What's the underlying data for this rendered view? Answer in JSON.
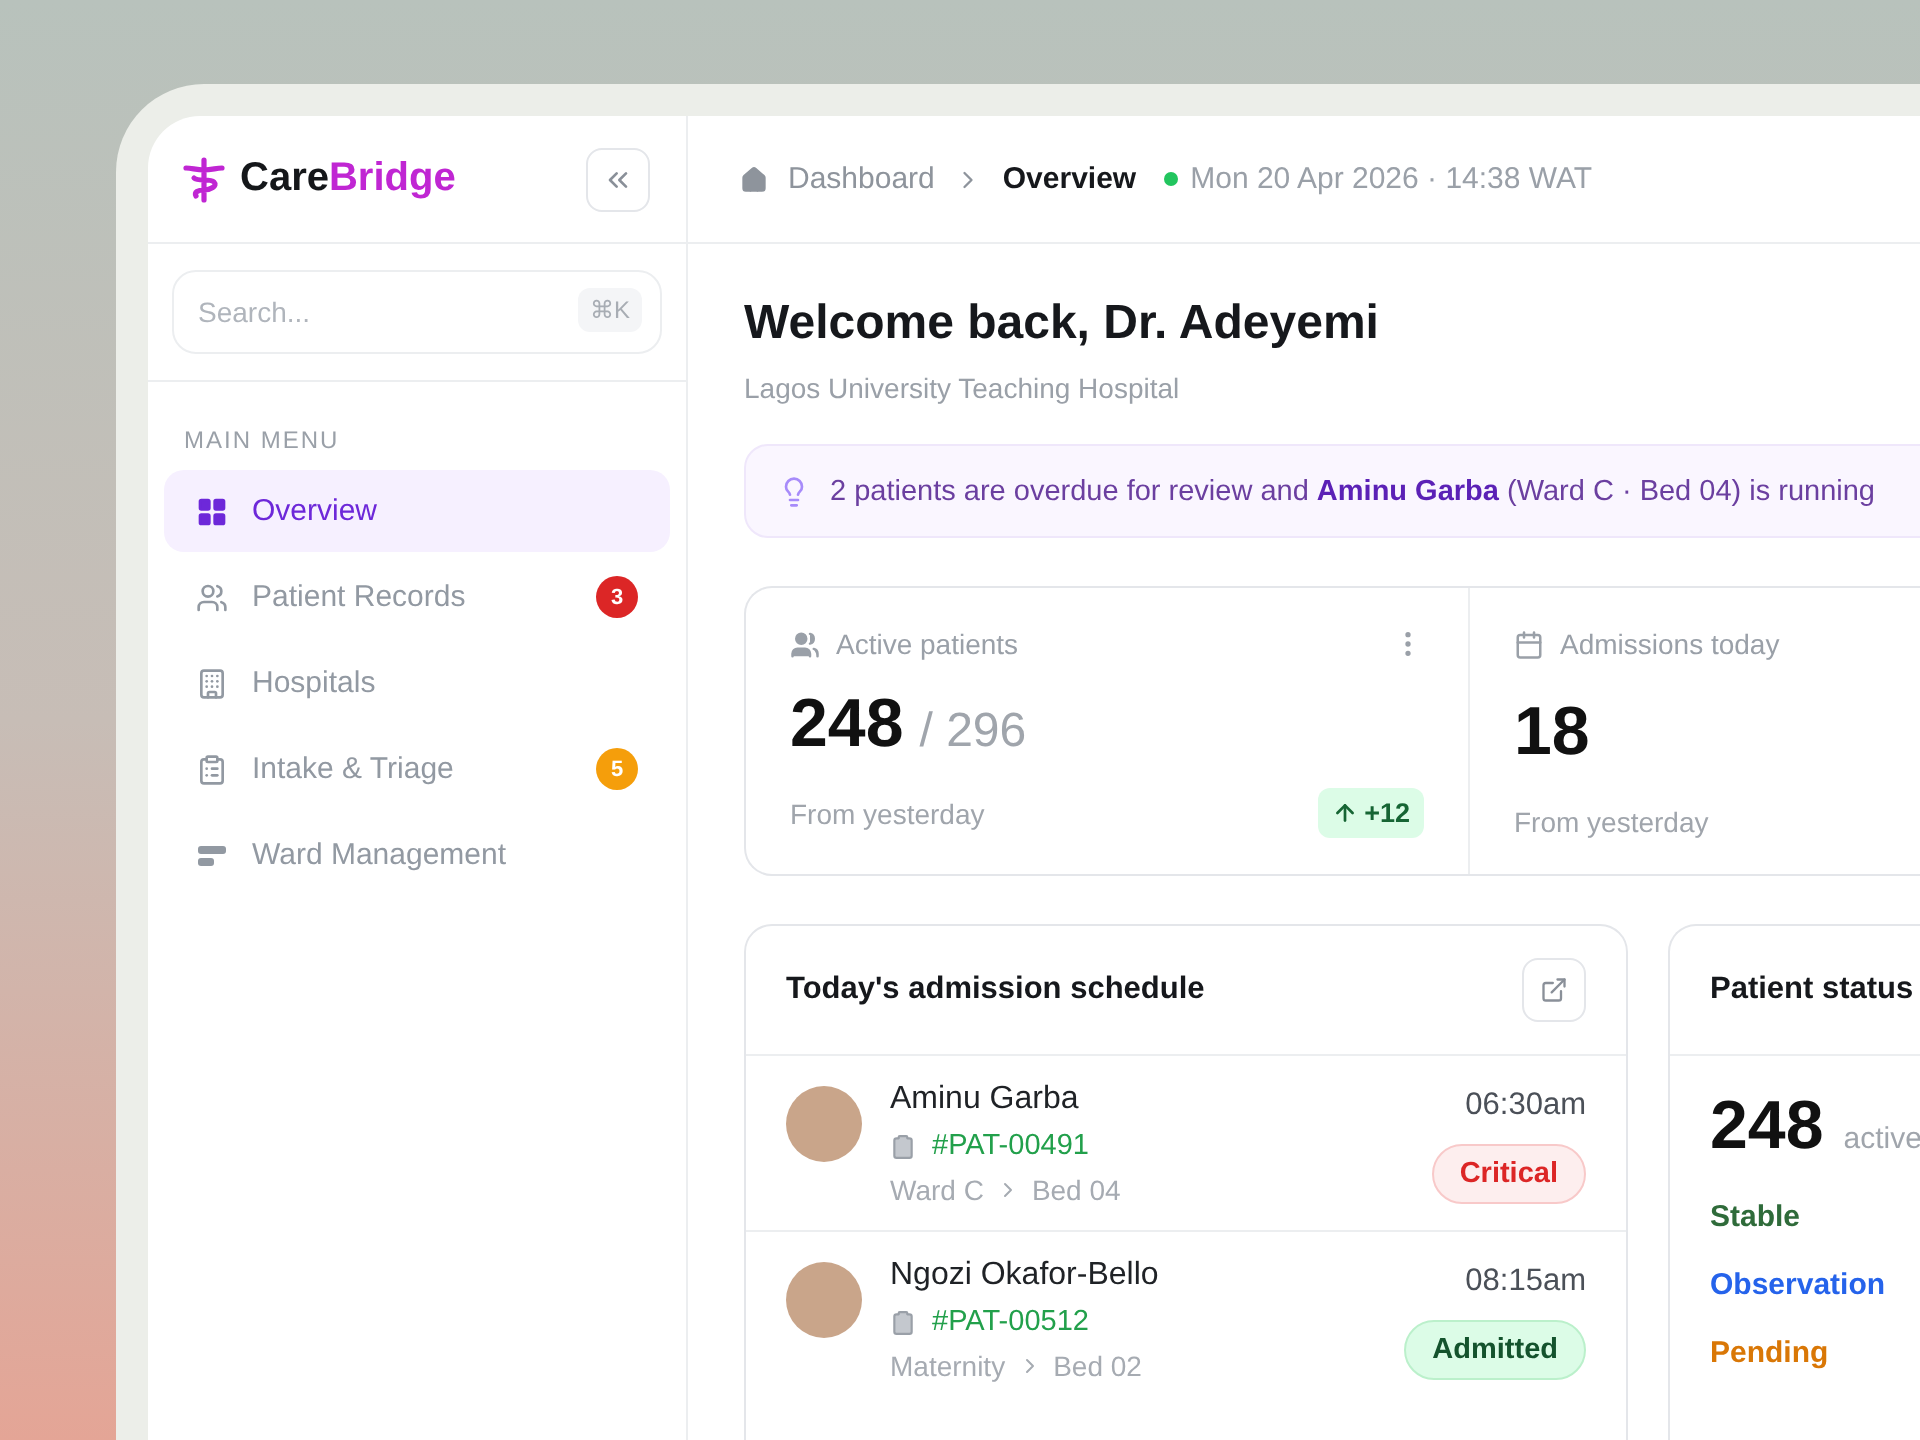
{
  "brand": {
    "name_start": "Care",
    "name_end": "Bridge"
  },
  "search": {
    "placeholder": "Search...",
    "shortcut": "⌘K"
  },
  "sidebar": {
    "section_title": "MAIN MENU",
    "items": [
      {
        "label": "Overview",
        "selected": true
      },
      {
        "label": "Patient Records",
        "selected": false,
        "badge": "3",
        "color": "#dc2626"
      },
      {
        "label": "Hospitals",
        "selected": false
      },
      {
        "label": "Intake & Triage",
        "selected": false,
        "badge": "5",
        "color": "#f59e0b"
      },
      {
        "label": "Ward Management",
        "selected": false
      }
    ]
  },
  "breadcrumb": {
    "root": "Dashboard",
    "current": "Overview",
    "timestamp": "Mon 20 Apr 2026 · 14:38 WAT"
  },
  "welcome": {
    "title": "Welcome back, Dr. Adeyemi",
    "subtitle": "Lagos University Teaching Hospital"
  },
  "alert": {
    "text": "2 patients are overdue for review and **Aminu Garba** (Ward C · Bed 04) is running"
  },
  "stats": [
    {
      "label": "Active patients",
      "value": "248",
      "total": "/ 296",
      "footnote": "From yesterday",
      "change": "+12"
    },
    {
      "label": "Admissions today",
      "value": "18",
      "footnote": "From yesterday"
    }
  ],
  "schedule": {
    "title": "Today's admission schedule",
    "rows": [
      {
        "name": "Aminu Garba",
        "patient_id": "#PAT-00491",
        "ward": "Ward C",
        "bed": "Bed 04",
        "time": "06:30am",
        "status": {
          "label": "Critical",
          "kind": "critical"
        }
      },
      {
        "name": "Ngozi Okafor-Bello",
        "patient_id": "#PAT-00512",
        "ward": "Maternity",
        "bed": "Bed 02",
        "time": "08:15am",
        "status": {
          "label": "Admitted",
          "kind": "admitted"
        }
      }
    ]
  },
  "patient_status": {
    "title": "Patient status",
    "total": "248",
    "total_label": "active",
    "items": [
      {
        "label": "Stable",
        "color": "#2f6b3a"
      },
      {
        "label": "Observation",
        "color": "#2563eb"
      },
      {
        "label": "Pending",
        "color": "#d97706"
      }
    ]
  }
}
